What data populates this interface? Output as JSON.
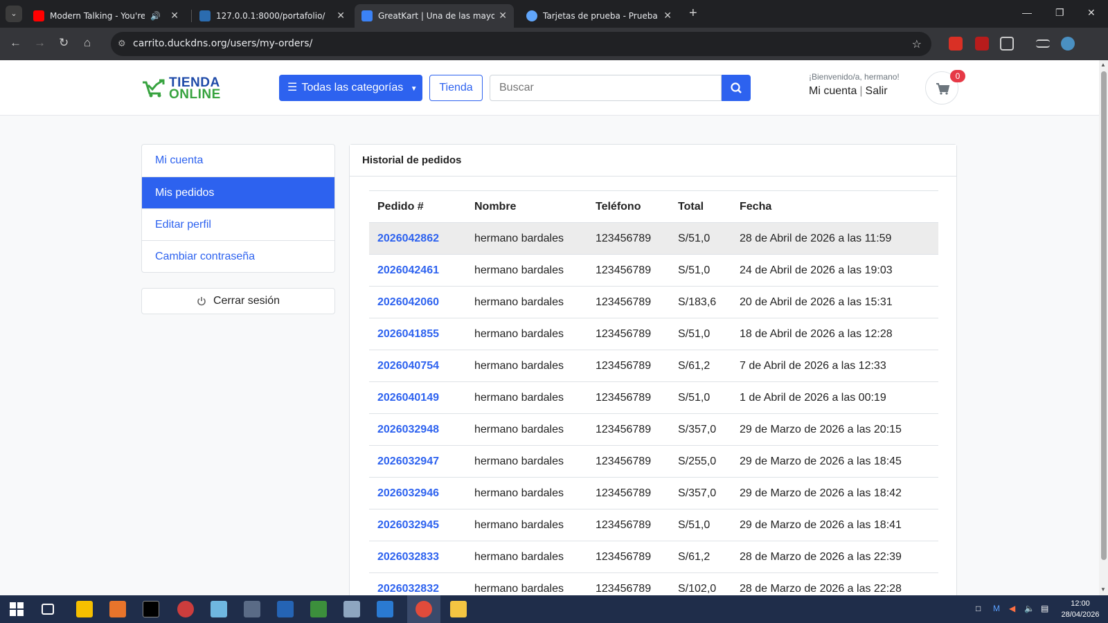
{
  "browser": {
    "tabs": [
      {
        "title": "Modern Talking - You're My",
        "favicon_color": "#ff0000",
        "audio": true
      },
      {
        "title": "127.0.0.1:8000/portafolio/",
        "favicon_color": "#2b6cb0",
        "audio": false
      },
      {
        "title": "GreatKart | Una de las mayores",
        "favicon_color": "#3b82f6",
        "audio": false,
        "active": true
      },
      {
        "title": "Tarjetas de prueba - Prueba de",
        "favicon_color": "#60a5fa",
        "audio": false
      }
    ],
    "url": "carrito.duckdns.org/users/my-orders/"
  },
  "header": {
    "logo_line1": "TIENDA",
    "logo_line2": "ONLINE",
    "categories_label": "Todas las categorías",
    "tienda_label": "Tienda",
    "search_placeholder": "Buscar",
    "welcome": "¡Bienvenido/a, hermano!",
    "account_label": "Mi cuenta",
    "logout_link": "Salir",
    "cart_count": "0",
    "accent_color": "#2d62ef"
  },
  "sidebar": {
    "items": [
      {
        "label": "Mi cuenta",
        "active": false
      },
      {
        "label": "Mis pedidos",
        "active": true
      },
      {
        "label": "Editar perfil",
        "active": false
      },
      {
        "label": "Cambiar contraseña",
        "active": false
      }
    ],
    "logout_label": "Cerrar sesión"
  },
  "orders": {
    "title": "Historial de pedidos",
    "columns": [
      "Pedido #",
      "Nombre",
      "Teléfono",
      "Total",
      "Fecha"
    ],
    "rows": [
      [
        "2026042862",
        "hermano bardales",
        "123456789",
        "S/51,0",
        "28 de Abril de 2026 a las 11:59"
      ],
      [
        "2026042461",
        "hermano bardales",
        "123456789",
        "S/51,0",
        "24 de Abril de 2026 a las 19:03"
      ],
      [
        "2026042060",
        "hermano bardales",
        "123456789",
        "S/183,6",
        "20 de Abril de 2026 a las 15:31"
      ],
      [
        "2026041855",
        "hermano bardales",
        "123456789",
        "S/51,0",
        "18 de Abril de 2026 a las 12:28"
      ],
      [
        "2026040754",
        "hermano bardales",
        "123456789",
        "S/61,2",
        "7 de Abril de 2026 a las 12:33"
      ],
      [
        "2026040149",
        "hermano bardales",
        "123456789",
        "S/51,0",
        "1 de Abril de 2026 a las 00:19"
      ],
      [
        "2026032948",
        "hermano bardales",
        "123456789",
        "S/357,0",
        "29 de Marzo de 2026 a las 20:15"
      ],
      [
        "2026032947",
        "hermano bardales",
        "123456789",
        "S/255,0",
        "29 de Marzo de 2026 a las 18:45"
      ],
      [
        "2026032946",
        "hermano bardales",
        "123456789",
        "S/357,0",
        "29 de Marzo de 2026 a las 18:42"
      ],
      [
        "2026032945",
        "hermano bardales",
        "123456789",
        "S/51,0",
        "29 de Marzo de 2026 a las 18:41"
      ],
      [
        "2026032833",
        "hermano bardales",
        "123456789",
        "S/61,2",
        "28 de Marzo de 2026 a las 22:39"
      ],
      [
        "2026032832",
        "hermano bardales",
        "123456789",
        "S/102,0",
        "28 de Marzo de 2026 a las 22:28"
      ]
    ]
  },
  "taskbar": {
    "time": "12:00",
    "date": "28/04/2026"
  }
}
